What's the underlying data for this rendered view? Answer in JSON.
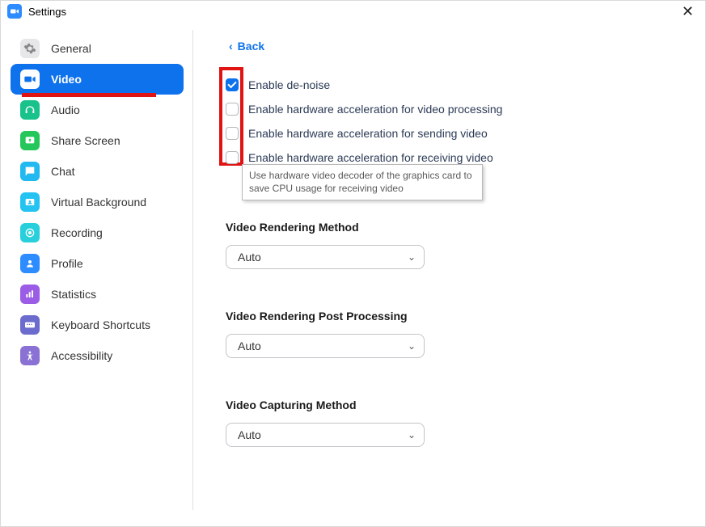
{
  "window": {
    "title": "Settings"
  },
  "sidebar": {
    "items": [
      {
        "label": "General"
      },
      {
        "label": "Video"
      },
      {
        "label": "Audio"
      },
      {
        "label": "Share Screen"
      },
      {
        "label": "Chat"
      },
      {
        "label": "Virtual Background"
      },
      {
        "label": "Recording"
      },
      {
        "label": "Profile"
      },
      {
        "label": "Statistics"
      },
      {
        "label": "Keyboard Shortcuts"
      },
      {
        "label": "Accessibility"
      }
    ],
    "active_index": 1
  },
  "content": {
    "back_label": "Back",
    "checkboxes": [
      {
        "label": "Enable de-noise",
        "checked": true
      },
      {
        "label": "Enable hardware acceleration for video processing",
        "checked": false
      },
      {
        "label": "Enable hardware acceleration for sending video",
        "checked": false
      },
      {
        "label": "Enable hardware acceleration for receiving video",
        "checked": false
      }
    ],
    "tooltip": "Use hardware video decoder of the graphics card to save CPU usage for receiving video",
    "sections": [
      {
        "title": "Video Rendering Method",
        "value": "Auto"
      },
      {
        "title": "Video Rendering Post Processing",
        "value": "Auto"
      },
      {
        "title": "Video Capturing Method",
        "value": "Auto"
      }
    ]
  },
  "annotations": {
    "red_highlight": "checkbox-column-and-video-tab"
  }
}
